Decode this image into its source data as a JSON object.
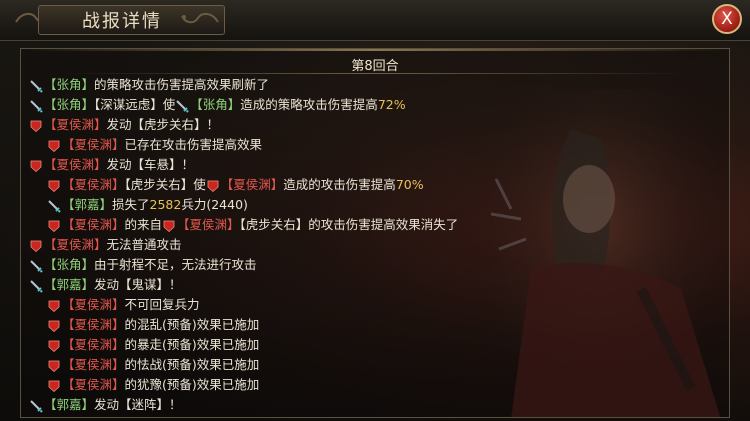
{
  "window": {
    "title": "战报详情",
    "close_label": "X"
  },
  "round": {
    "label": "第8回合"
  },
  "colors": {
    "ally_name": "#8fd07a",
    "enemy_name": "#e0574e",
    "number": "#e8c15a",
    "text": "#eae3d3"
  },
  "log": [
    {
      "indent": 0,
      "parts": [
        {
          "t": "icon",
          "v": "sword-icon"
        },
        {
          "t": "g",
          "v": "【张角】"
        },
        {
          "t": "w",
          "v": "的策略攻击伤害提高效果刷新了"
        }
      ]
    },
    {
      "indent": 0,
      "parts": [
        {
          "t": "icon",
          "v": "sword-icon"
        },
        {
          "t": "g",
          "v": "【张角】"
        },
        {
          "t": "w",
          "v": "【深谋远虑】使"
        },
        {
          "t": "icon",
          "v": "sword-icon"
        },
        {
          "t": "g",
          "v": "【张角】"
        },
        {
          "t": "w",
          "v": "造成的策略攻击伤害提高"
        },
        {
          "t": "n",
          "v": "72%"
        }
      ]
    },
    {
      "indent": 0,
      "parts": [
        {
          "t": "icon",
          "v": "shield-icon"
        },
        {
          "t": "r",
          "v": "【夏侯渊】"
        },
        {
          "t": "w",
          "v": "发动【虎步关右】！"
        }
      ]
    },
    {
      "indent": 1,
      "parts": [
        {
          "t": "icon",
          "v": "shield-icon"
        },
        {
          "t": "r",
          "v": "【夏侯渊】"
        },
        {
          "t": "w",
          "v": "已存在攻击伤害提高效果"
        }
      ]
    },
    {
      "indent": 0,
      "parts": [
        {
          "t": "icon",
          "v": "shield-icon"
        },
        {
          "t": "r",
          "v": "【夏侯渊】"
        },
        {
          "t": "w",
          "v": "发动【车悬】！"
        }
      ]
    },
    {
      "indent": 1,
      "parts": [
        {
          "t": "icon",
          "v": "shield-icon"
        },
        {
          "t": "r",
          "v": "【夏侯渊】"
        },
        {
          "t": "w",
          "v": "【虎步关右】使"
        },
        {
          "t": "icon",
          "v": "shield-icon"
        },
        {
          "t": "r",
          "v": "【夏侯渊】"
        },
        {
          "t": "w",
          "v": "造成的攻击伤害提高"
        },
        {
          "t": "n",
          "v": "70%"
        }
      ]
    },
    {
      "indent": 1,
      "parts": [
        {
          "t": "icon",
          "v": "sword-icon"
        },
        {
          "t": "g",
          "v": "【郭嘉】"
        },
        {
          "t": "w",
          "v": "损失了"
        },
        {
          "t": "n",
          "v": "2582"
        },
        {
          "t": "w",
          "v": "兵力(2440)"
        }
      ]
    },
    {
      "indent": 1,
      "parts": [
        {
          "t": "icon",
          "v": "shield-icon"
        },
        {
          "t": "r",
          "v": "【夏侯渊】"
        },
        {
          "t": "w",
          "v": "的来自"
        },
        {
          "t": "icon",
          "v": "shield-icon"
        },
        {
          "t": "r",
          "v": "【夏侯渊】"
        },
        {
          "t": "w",
          "v": "【虎步关右】的攻击伤害提高效果消失了"
        }
      ]
    },
    {
      "indent": 0,
      "parts": [
        {
          "t": "icon",
          "v": "shield-icon"
        },
        {
          "t": "r",
          "v": "【夏侯渊】"
        },
        {
          "t": "w",
          "v": "无法普通攻击"
        }
      ]
    },
    {
      "indent": 0,
      "parts": [
        {
          "t": "icon",
          "v": "sword-icon"
        },
        {
          "t": "g",
          "v": "【张角】"
        },
        {
          "t": "w",
          "v": "由于射程不足，无法进行攻击"
        }
      ]
    },
    {
      "indent": 0,
      "parts": [
        {
          "t": "icon",
          "v": "sword-icon"
        },
        {
          "t": "g",
          "v": "【郭嘉】"
        },
        {
          "t": "w",
          "v": "发动【鬼谋】！"
        }
      ]
    },
    {
      "indent": 1,
      "parts": [
        {
          "t": "icon",
          "v": "shield-icon"
        },
        {
          "t": "r",
          "v": "【夏侯渊】"
        },
        {
          "t": "w",
          "v": "不可回复兵力"
        }
      ]
    },
    {
      "indent": 1,
      "parts": [
        {
          "t": "icon",
          "v": "shield-icon"
        },
        {
          "t": "r",
          "v": "【夏侯渊】"
        },
        {
          "t": "w",
          "v": "的混乱(预备)效果已施加"
        }
      ]
    },
    {
      "indent": 1,
      "parts": [
        {
          "t": "icon",
          "v": "shield-icon"
        },
        {
          "t": "r",
          "v": "【夏侯渊】"
        },
        {
          "t": "w",
          "v": "的暴走(预备)效果已施加"
        }
      ]
    },
    {
      "indent": 1,
      "parts": [
        {
          "t": "icon",
          "v": "shield-icon"
        },
        {
          "t": "r",
          "v": "【夏侯渊】"
        },
        {
          "t": "w",
          "v": "的怯战(预备)效果已施加"
        }
      ]
    },
    {
      "indent": 1,
      "parts": [
        {
          "t": "icon",
          "v": "shield-icon"
        },
        {
          "t": "r",
          "v": "【夏侯渊】"
        },
        {
          "t": "w",
          "v": "的犹豫(预备)效果已施加"
        }
      ]
    },
    {
      "indent": 0,
      "parts": [
        {
          "t": "icon",
          "v": "sword-icon"
        },
        {
          "t": "g",
          "v": "【郭嘉】"
        },
        {
          "t": "w",
          "v": "发动【迷阵】！"
        }
      ]
    }
  ]
}
